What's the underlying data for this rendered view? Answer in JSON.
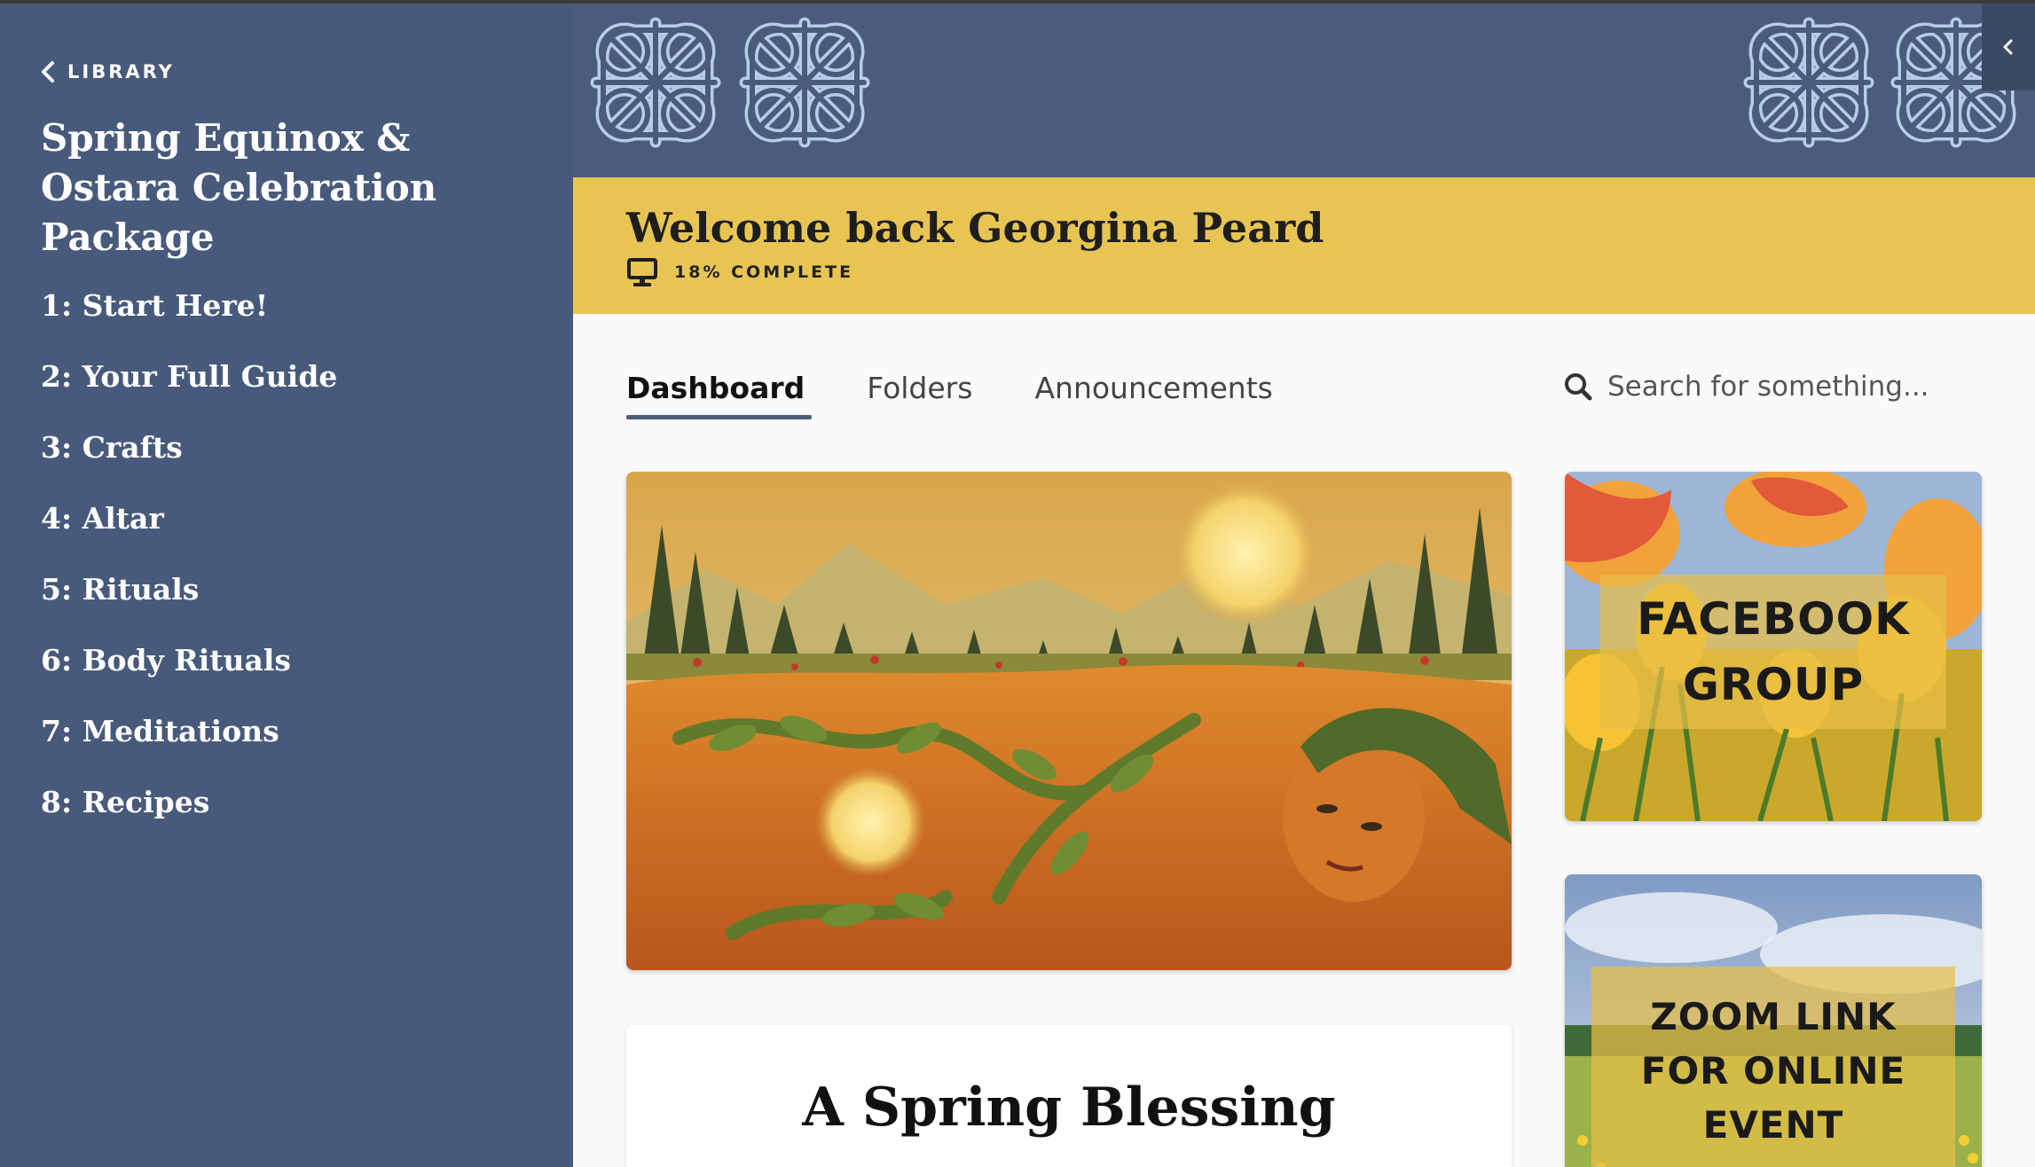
{
  "sidebar": {
    "back_label": "LIBRARY",
    "course_title": "Spring Equinox & Ostara Celebration Package",
    "items": [
      {
        "label": "1: Start Here!"
      },
      {
        "label": "2: Your Full Guide"
      },
      {
        "label": "3: Crafts"
      },
      {
        "label": "4: Altar"
      },
      {
        "label": "5: Rituals"
      },
      {
        "label": "6: Body Rituals"
      },
      {
        "label": "7: Meditations"
      },
      {
        "label": "8: Recipes"
      }
    ]
  },
  "header": {
    "welcome": "Welcome back Georgina Peard",
    "progress_text": "18% COMPLETE",
    "progress_percent": 18,
    "banner_pattern": "celtic-knot-icon",
    "collapse_icon": "chevron-left-icon"
  },
  "tabs": [
    {
      "label": "Dashboard",
      "active": true
    },
    {
      "label": "Folders",
      "active": false
    },
    {
      "label": "Announcements",
      "active": false
    }
  ],
  "search": {
    "placeholder": "Search for something..."
  },
  "main": {
    "hero_image": "painting-earth-goddess-lying-in-landscape",
    "blessing_title": "A Spring Blessing"
  },
  "side_cards": [
    {
      "label_lines": [
        "FACEBOOK",
        "GROUP"
      ],
      "image": "tulips-photo"
    },
    {
      "label_lines": [
        "ZOOM LINK",
        "FOR ONLINE",
        "EVENT"
      ],
      "image": "meadow-photo"
    }
  ],
  "colors": {
    "sidebar": "#485a7b",
    "banner": "#4a5b7c",
    "welcome_bar": "#e8c553",
    "card_overlay": "#e8be46"
  }
}
